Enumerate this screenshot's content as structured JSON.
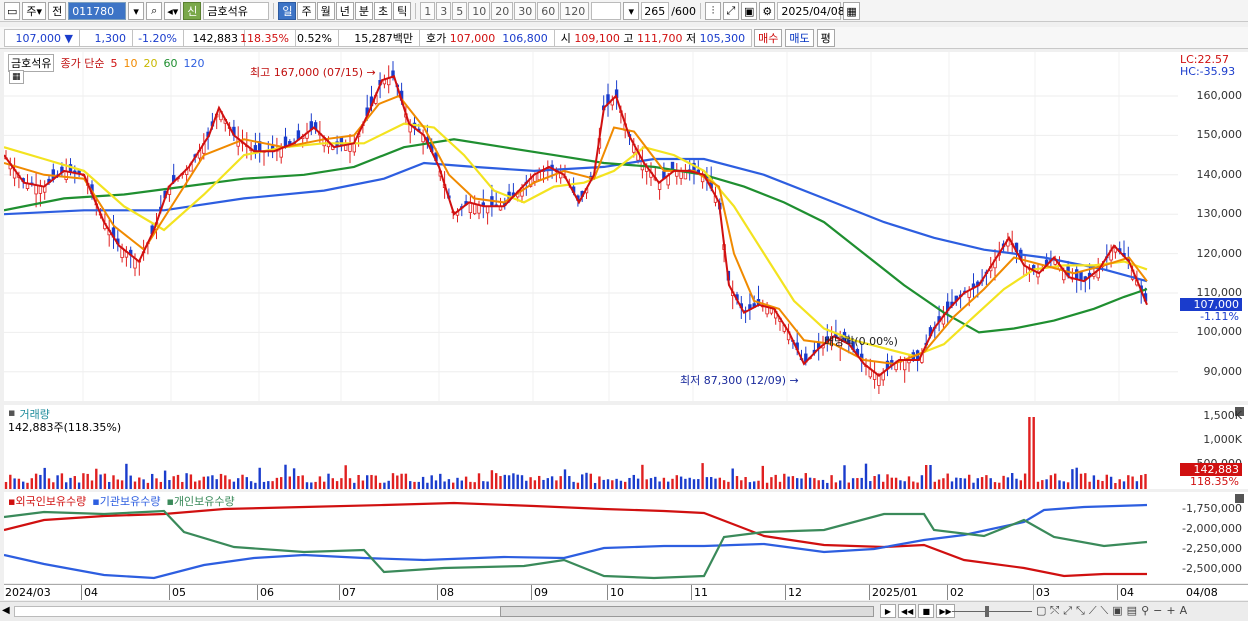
{
  "toolbar1": {
    "ju_label": "주",
    "jeon_label": "전",
    "code_value": "011780",
    "shin_label": "신",
    "stock_name": "금호석유",
    "period_tabs": [
      "일",
      "주",
      "월",
      "년",
      "분",
      "초",
      "틱"
    ],
    "active_period": "일",
    "minute_buttons": [
      "1",
      "3",
      "5",
      "10",
      "20",
      "30",
      "60",
      "120"
    ],
    "count_value": "265",
    "count_total": "/600",
    "date_value": "2025/04/08"
  },
  "toolbar2": {
    "price": "107,000",
    "change": "1,300",
    "change_pct": "-1.20%",
    "volume": "142,883",
    "volume_ratio": "118.35%",
    "rate": "0.52%",
    "amount": "15,287백만",
    "hoga_label": "호가",
    "hoga_sell": "107,000",
    "hoga_buy": "106,800",
    "open_label": "시",
    "open_value": "109,100",
    "high_label": "고",
    "high_value": "111,700",
    "low_label": "저",
    "low_value": "105,300",
    "buy_label": "매수",
    "sell_label": "매도",
    "pyeong_label": "평"
  },
  "main_chart": {
    "name_tag": "금호석유",
    "ma_label": "종가 단순",
    "ma_periods": [
      "5",
      "10",
      "20",
      "60",
      "120"
    ],
    "ma_colors": [
      "#d01010",
      "#f08a00",
      "#f3e320",
      "#1f8f30",
      "#2d5ee0"
    ],
    "high_annotation": "최고 167,000 (07/15)",
    "low_annotation": "최저 87,300 (12/09)",
    "dividend_annotation": "배당락(0.00%)",
    "lc_label": "LC:22.57",
    "hc_label": "HC:-35.93",
    "price_ticks": [
      "160,000",
      "150,000",
      "140,000",
      "130,000",
      "120,000",
      "110,000",
      "100,000",
      "90,000"
    ],
    "current_price_badge": "107,000",
    "current_change_badge": "-1.11%"
  },
  "volume_chart": {
    "title": "거래량",
    "value_text": "142,883주(118.35%)",
    "ticks": [
      "1,500K",
      "1,000K",
      "500,000"
    ],
    "badge_value": "142,883",
    "badge_pct": "118.35%"
  },
  "ownership_chart": {
    "legend": [
      "외국인보유수량",
      "기관보유수량",
      "개인보유수량"
    ],
    "ticks": [
      "-1,750,000",
      "-2,000,000",
      "-2,250,000",
      "-2,500,000"
    ]
  },
  "time_axis": [
    "2024/03",
    "04",
    "05",
    "06",
    "07",
    "08",
    "09",
    "10",
    "11",
    "12",
    "2025/01",
    "02",
    "03",
    "04",
    "04/08"
  ],
  "chart_data": {
    "type": "line",
    "title": "",
    "series": [
      {
        "name": "5",
        "color": "#d01010"
      },
      {
        "name": "10",
        "color": "#f08a00"
      },
      {
        "name": "20",
        "color": "#f3e320"
      },
      {
        "name": "60",
        "color": "#1f8f30"
      },
      {
        "name": "120",
        "color": "#2d5ee0"
      }
    ],
    "ylim": [
      85000,
      170000
    ],
    "annotations": [
      "최고 167,000 (07/15)",
      "최저 87,300 (12/09)",
      "배당락(0.00%)"
    ],
    "last_close": 107000
  }
}
